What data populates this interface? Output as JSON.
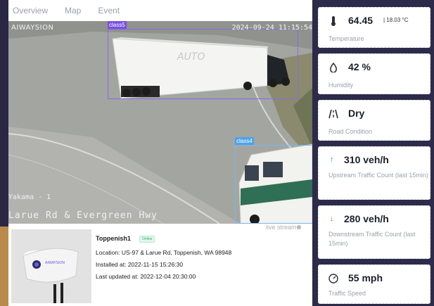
{
  "tabs": [
    "Overview",
    "Map",
    "Event"
  ],
  "camera": {
    "brand": "AIWAYSION",
    "timestamp": "2024-09-24 11:15:54",
    "place": "Yakama - 1",
    "road": "Larue Rd & Evergreen Hwy",
    "tag_a": "class5",
    "tag_b": "class4",
    "live_stream_label": "live stream:"
  },
  "device": {
    "name": "Toppenish1",
    "status": "Online",
    "location": "Location: US-97 & Larue Rd, Toppenish, WA 98948",
    "installed": "Installed at: 2022-11-15 15:26:30",
    "updated": "Last updated at: 2022-12-04 20:30:00",
    "logo_text": "AIWAYSION"
  },
  "metrics": [
    {
      "icon": "thermometer-icon",
      "value": "64.45",
      "secondary": "| 18.03 °C",
      "label": "Temperature"
    },
    {
      "icon": "humidity-drop-icon",
      "value": "42 %",
      "label": "Humidity"
    },
    {
      "icon": "road-icon",
      "value": "Dry",
      "label": "Road Condition"
    },
    {
      "icon": "arrow-up-icon",
      "value": "310 veh/h",
      "label": "Upstream Traffic Count (last 15min)",
      "accent": "#2fa36b"
    },
    {
      "icon": "arrow-down-icon",
      "value": "280 veh/h",
      "label": "Downstream Traffic Count (last 15min)",
      "accent": "#e24a4a"
    },
    {
      "icon": "speedometer-icon",
      "value": "55 mph",
      "label": "Traffic Speed"
    }
  ],
  "colors": {
    "background": "#2e2a4a",
    "bbox_purple": "#8a6ae8",
    "bbox_blue": "#4da3e6",
    "online_green": "#35a86a"
  }
}
